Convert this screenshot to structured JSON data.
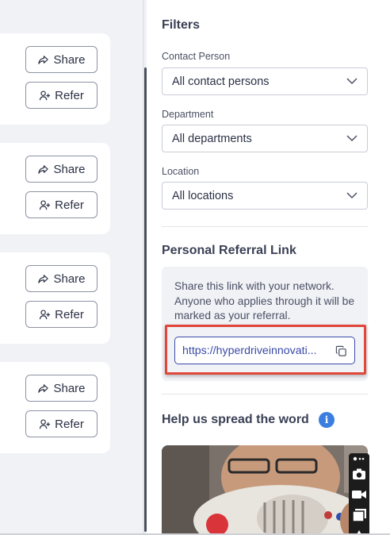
{
  "jobs": [
    {
      "share_label": "Share",
      "refer_label": "Refer"
    },
    {
      "share_label": "Share",
      "refer_label": "Refer"
    },
    {
      "share_label": "Share",
      "refer_label": "Refer"
    },
    {
      "share_label": "Share",
      "refer_label": "Refer"
    }
  ],
  "filters": {
    "title": "Filters",
    "contact_person": {
      "label": "Contact Person",
      "value": "All contact persons"
    },
    "department": {
      "label": "Department",
      "value": "All departments"
    },
    "location": {
      "label": "Location",
      "value": "All locations"
    }
  },
  "referral": {
    "title": "Personal Referral Link",
    "description": "Share this link with your network. Anyone who applies through it will be marked as your referral.",
    "link": "https://hyperdriveinnovati...",
    "highlight_color": "#e0473a"
  },
  "help": {
    "title": "Help us spread the word",
    "info_icon": "info-icon"
  },
  "colors": {
    "accent": "#3b4aa8",
    "info": "#3c7ee0",
    "background": "#f1f2f6"
  }
}
